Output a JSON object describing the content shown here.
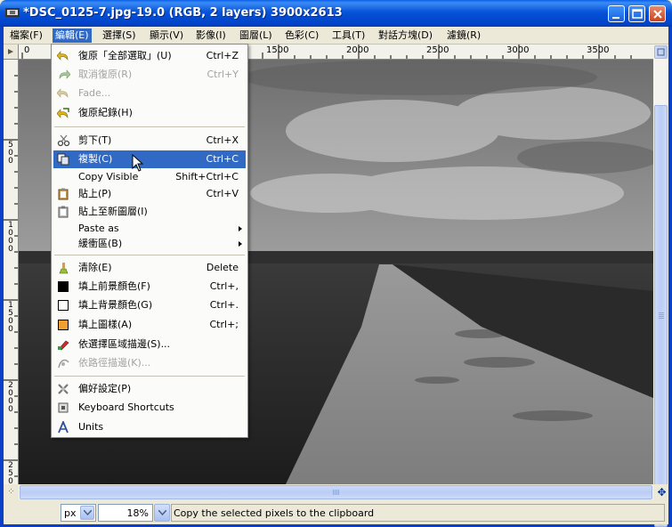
{
  "window": {
    "title": "*DSC_0125-7.jpg-19.0 (RGB, 2 layers) 3900x2613"
  },
  "menubar": [
    {
      "label": "檔案(F)"
    },
    {
      "label": "編輯(E)"
    },
    {
      "label": "選擇(S)"
    },
    {
      "label": "顯示(V)"
    },
    {
      "label": "影像(I)"
    },
    {
      "label": "圖層(L)"
    },
    {
      "label": "色彩(C)"
    },
    {
      "label": "工具(T)"
    },
    {
      "label": "對話方塊(D)"
    },
    {
      "label": "濾鏡(R)"
    }
  ],
  "ruler": {
    "h_labels": [
      "0",
      "1500",
      "2000",
      "2500",
      "3000",
      "3500"
    ],
    "v_labels": [
      "5 0 0",
      "1 0 0 0",
      "1 5 0 0",
      "2 0 0 0",
      "2 5 0 0"
    ]
  },
  "edit_menu": {
    "items": [
      {
        "label": "復原「全部選取」(U)",
        "accel": "Ctrl+Z",
        "icon": "undo-icon"
      },
      {
        "label": "取消復原(R)",
        "accel": "Ctrl+Y",
        "icon": "redo-icon"
      },
      {
        "label": "Fade...",
        "accel": "",
        "icon": "fade-icon"
      },
      {
        "label": "復原紀錄(H)",
        "accel": "",
        "icon": "undo-history-icon"
      },
      {
        "label": "剪下(T)",
        "accel": "Ctrl+X",
        "icon": "cut-icon"
      },
      {
        "label": "複製(C)",
        "accel": "Ctrl+C",
        "icon": "copy-icon"
      },
      {
        "label": "Copy Visible",
        "accel": "Shift+Ctrl+C",
        "icon": ""
      },
      {
        "label": "貼上(P)",
        "accel": "Ctrl+V",
        "icon": "paste-icon"
      },
      {
        "label": "貼上至新圖層(I)",
        "accel": "",
        "icon": "paste-new-layer-icon"
      },
      {
        "label": "Paste as",
        "accel": "",
        "icon": ""
      },
      {
        "label": "緩衝區(B)",
        "accel": "",
        "icon": ""
      },
      {
        "label": "清除(E)",
        "accel": "Delete",
        "icon": "clear-icon"
      },
      {
        "label": "填上前景顏色(F)",
        "accel": "Ctrl+,",
        "icon": "fg-color-swatch-icon"
      },
      {
        "label": "填上背景顏色(G)",
        "accel": "Ctrl+.",
        "icon": "bg-color-swatch-icon"
      },
      {
        "label": "填上圖樣(A)",
        "accel": "Ctrl+;",
        "icon": "pattern-swatch-icon"
      },
      {
        "label": "依選擇區域描邊(S)...",
        "accel": "",
        "icon": "stroke-selection-icon"
      },
      {
        "label": "依路徑描邊(K)...",
        "accel": "",
        "icon": "stroke-path-icon"
      },
      {
        "label": "偏好設定(P)",
        "accel": "",
        "icon": "preferences-icon"
      },
      {
        "label": "Keyboard Shortcuts",
        "accel": "",
        "icon": "keyboard-icon"
      },
      {
        "label": "Units",
        "accel": "",
        "icon": "units-icon"
      }
    ],
    "selected_index": 5
  },
  "statusbar": {
    "unit": "px",
    "zoom": "18%",
    "message": "Copy the selected pixels to the clipboard"
  },
  "colors": {
    "title_bar": "#0653d9",
    "menu_highlight": "#316ac5",
    "window_bg": "#ece9d8"
  }
}
